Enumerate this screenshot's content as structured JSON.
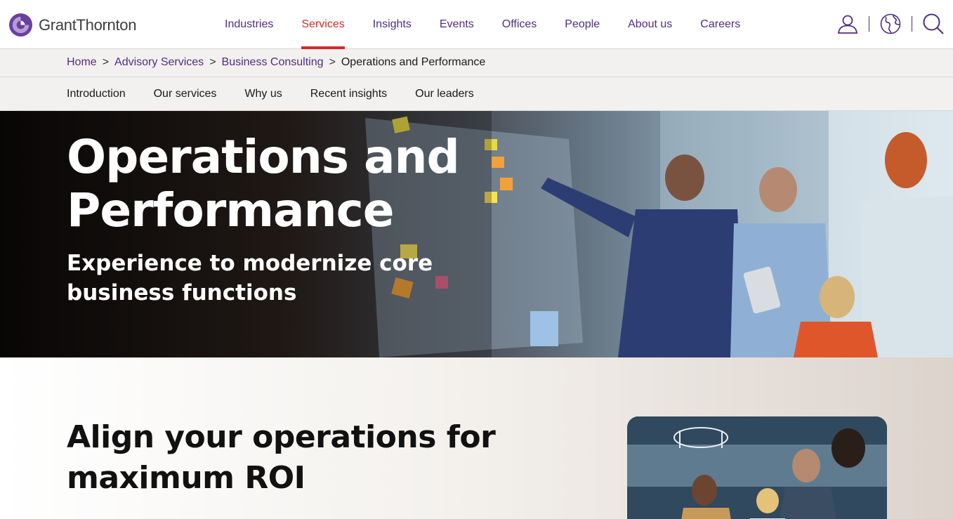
{
  "brand": {
    "name": "GrantThornton",
    "accent": "#4f2d7f",
    "active": "#ce2c2c"
  },
  "nav": {
    "items": [
      "Industries",
      "Services",
      "Insights",
      "Events",
      "Offices",
      "People",
      "About us",
      "Careers"
    ],
    "active": "Services"
  },
  "utility": {
    "icons": [
      "user-icon",
      "globe-icon",
      "search-icon"
    ]
  },
  "breadcrumb": {
    "links": [
      "Home",
      "Advisory Services",
      "Business Consulting"
    ],
    "separator": ">",
    "current": "Operations and Performance"
  },
  "subnav": {
    "items": [
      "Introduction",
      "Our services",
      "Why us",
      "Recent insights",
      "Our leaders"
    ]
  },
  "hero": {
    "title": "Operations and Performance",
    "subtitle": "Experience to modernize core business functions"
  },
  "section": {
    "title": "Align your operations for maximum ROI"
  }
}
